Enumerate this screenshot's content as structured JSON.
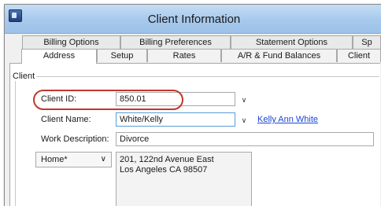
{
  "window": {
    "title": "Client Information"
  },
  "tabs_row1": [
    "Billing Options",
    "Billing Preferences",
    "Statement Options",
    "Sp"
  ],
  "tabs_row2": [
    "Address",
    "Setup",
    "Rates",
    "A/R & Fund Balances",
    "Client"
  ],
  "active_tab": "Address",
  "group": {
    "label": "Client"
  },
  "fields": {
    "client_id": {
      "label": "Client ID:",
      "value": "850.01"
    },
    "client_name": {
      "label": "Client Name:",
      "value": "White/Kelly",
      "link": "Kelly Ann White"
    },
    "work_description": {
      "label": "Work Description:",
      "value": "Divorce"
    }
  },
  "address": {
    "type_selected": "Home*",
    "line1": "201, 122nd Avenue East",
    "line2": "Los Angeles CA  98507"
  },
  "colors": {
    "highlight": "#c0392b",
    "link": "#1a45d6",
    "titlebar": "#a7c9ec"
  },
  "icons": [
    "app-icon",
    "chevron-down-icon"
  ]
}
